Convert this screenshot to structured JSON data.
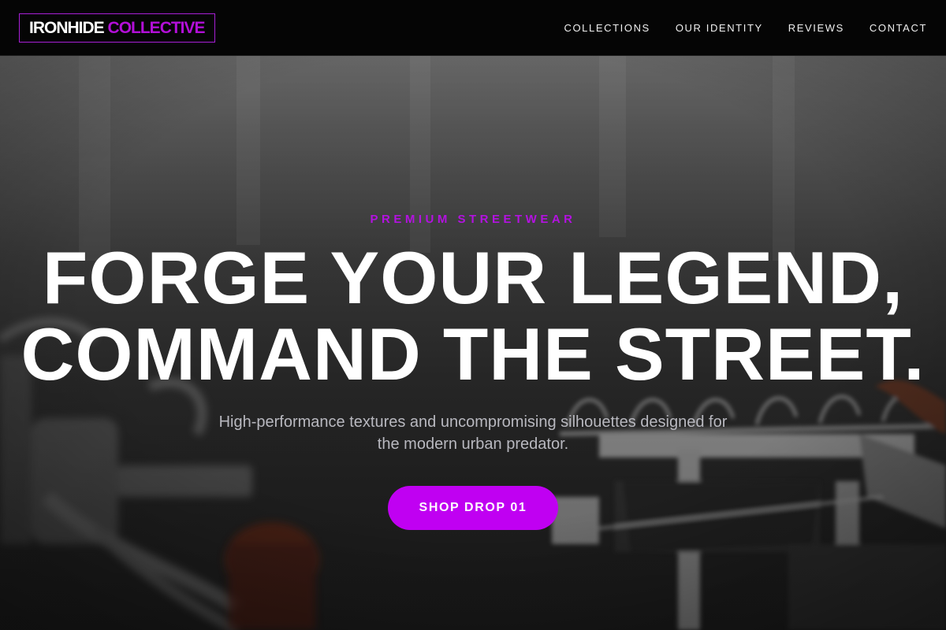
{
  "nav": {
    "logo": {
      "primary": "IRONHIDE",
      "accent": "COLLECTIVE"
    },
    "links": [
      "COLLECTIONS",
      "OUR IDENTITY",
      "REVIEWS",
      "CONTACT"
    ]
  },
  "hero": {
    "eyebrow": "PREMIUM STREETWEAR",
    "headline_line1": "FORGE YOUR LEGEND,",
    "headline_line2": "COMMAND THE STREET.",
    "subtext": "High-performance textures and uncompromising silhouettes designed for the modern urban predator.",
    "cta_label": "SHOP DROP 01",
    "background_image": "clothing-rack-with-hangers-photo"
  },
  "colors": {
    "accent": "#c000f2",
    "nav_bg": "#050505",
    "subtext": "#b8b8bf"
  }
}
